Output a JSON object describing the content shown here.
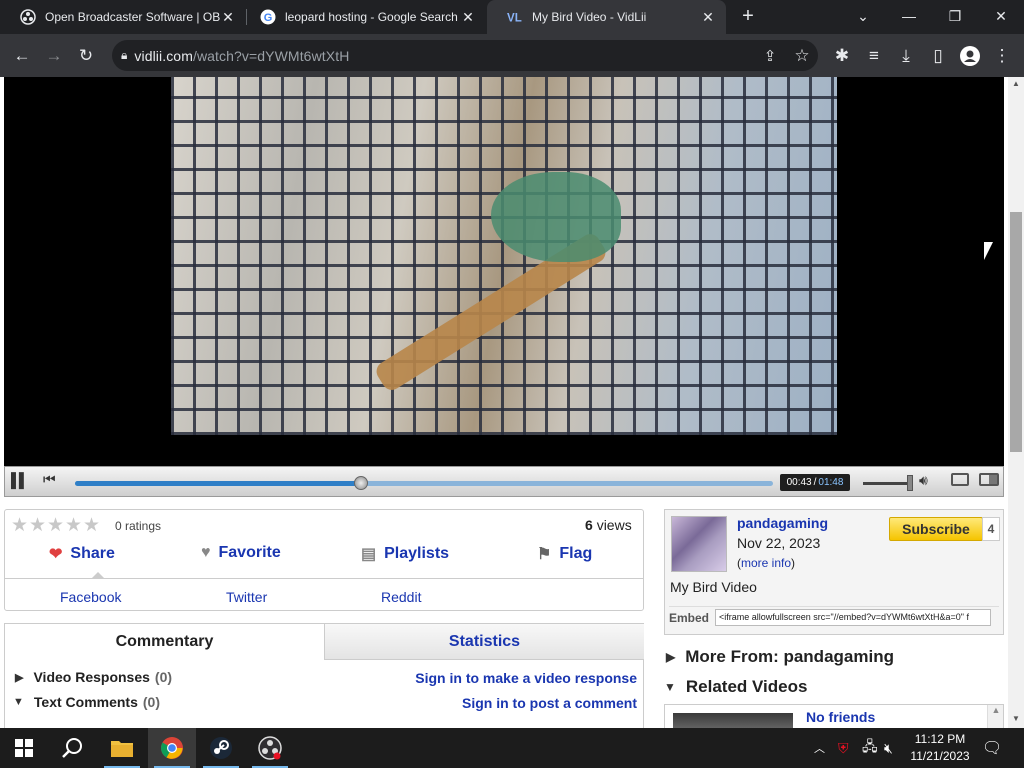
{
  "browser": {
    "tabs": [
      {
        "title": "Open Broadcaster Software | OB",
        "icon": "obs-icon",
        "active": false
      },
      {
        "title": "leopard hosting - Google Search",
        "icon": "google-icon",
        "active": false
      },
      {
        "title": "My Bird Video - VidLii",
        "icon": "vidlii-icon",
        "active": true
      }
    ],
    "new_tab_symbol": "+",
    "address": {
      "host": "vidlii.com",
      "path": "/watch?v=dYWMt6wtXtH"
    }
  },
  "player": {
    "current_time": "00:43",
    "separator": "/",
    "duration": "01:48",
    "progress": 0.41,
    "volume": 0.9
  },
  "video_info": {
    "ratings_text": "0 ratings",
    "star_count": 5,
    "views_count": "6",
    "views_label": "views",
    "actions": {
      "share": "Share",
      "favorite": "Favorite",
      "playlists": "Playlists",
      "flag": "Flag"
    },
    "share_links": {
      "facebook": "Facebook",
      "twitter": "Twitter",
      "reddit": "Reddit"
    }
  },
  "comments": {
    "tab_commentary": "Commentary",
    "tab_statistics": "Statistics",
    "video_responses_label": "Video Responses",
    "video_responses_count": "(0)",
    "text_comments_label": "Text Comments",
    "text_comments_count": "(0)",
    "sign_in_response": "Sign in to make a video response",
    "sign_in_comment": "Sign in to post a comment"
  },
  "uploader": {
    "username": "pandagaming",
    "join_date": "Nov 22, 2023",
    "more_info_open": "(",
    "more_info_link": "more info",
    "more_info_close": ")",
    "subscribe_label": "Subscribe",
    "subscriber_count": "4",
    "video_title": "My Bird Video",
    "embed_label": "Embed",
    "embed_code": "<iframe allowfullscreen src=\"//embed?v=dYWMt6wtXtH&a=0\" f"
  },
  "sidebar": {
    "more_from": "More From: pandagaming",
    "related_videos": "Related Videos",
    "related_first_title": "No friends"
  },
  "taskbar": {
    "clock_time": "11:12 PM",
    "clock_date": "11/21/2023"
  },
  "colors": {
    "link_blue": "#1a36b0",
    "subscribe_yellow": "#f5c400",
    "seek_blue": "#2f7fc7"
  }
}
